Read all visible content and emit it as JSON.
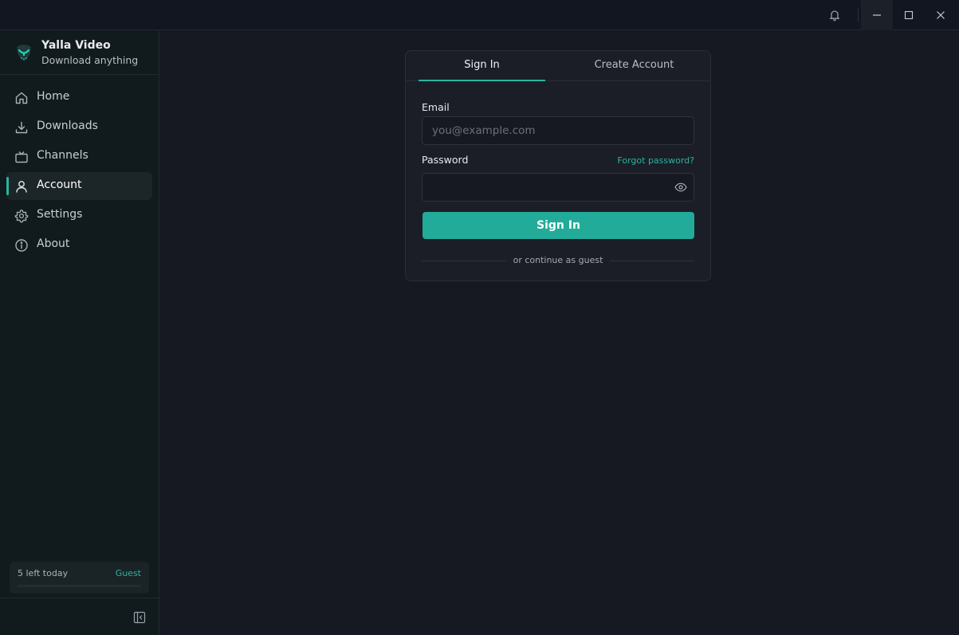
{
  "app": {
    "name": "Yalla Video",
    "tagline": "Download anything",
    "accent_color": "#2bb3a0"
  },
  "titlebar": {
    "icons": [
      "bell-icon",
      "minimize-icon",
      "maximize-icon",
      "close-icon"
    ]
  },
  "sidebar": {
    "items": [
      {
        "label": "Home",
        "icon": "home-icon",
        "active": false
      },
      {
        "label": "Downloads",
        "icon": "download-icon",
        "active": false
      },
      {
        "label": "Channels",
        "icon": "tv-icon",
        "active": false
      },
      {
        "label": "Account",
        "icon": "user-icon",
        "active": true
      },
      {
        "label": "Settings",
        "icon": "gear-icon",
        "active": false
      },
      {
        "label": "About",
        "icon": "info-icon",
        "active": false
      }
    ],
    "quota": {
      "text": "5 left today",
      "tier": "Guest",
      "used_fraction": 0
    }
  },
  "auth": {
    "tabs": [
      {
        "label": "Sign In",
        "active": true
      },
      {
        "label": "Create Account",
        "active": false
      }
    ],
    "email": {
      "label": "Email",
      "placeholder": "you@example.com",
      "value": ""
    },
    "password": {
      "label": "Password",
      "value": "",
      "forgot_label": "Forgot password?"
    },
    "submit_label": "Sign In",
    "guest_label": "or continue as guest"
  }
}
